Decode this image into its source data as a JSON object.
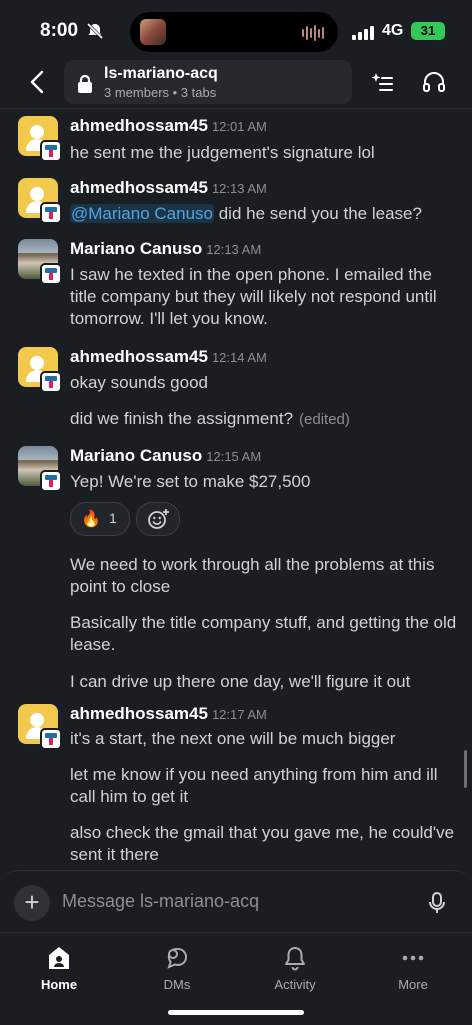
{
  "status_bar": {
    "time": "8:00",
    "network": "4G",
    "battery": "31"
  },
  "header": {
    "channel_name": "ls-mariano-acq",
    "channel_meta": "3 members • 3 tabs"
  },
  "messages": [
    {
      "author": "ahmedhossam45",
      "time": "12:01 AM",
      "lines": [
        "he sent me the judgement's signature lol"
      ]
    },
    {
      "author": "ahmedhossam45",
      "time": "12:13 AM",
      "mention": "@Mariano Canuso",
      "text": " did he send you the lease?"
    },
    {
      "author": "Mariano Canuso",
      "time": "12:13 AM",
      "text": "I saw he texted in the open phone. I emailed the title company but they will likely not respond until tomorrow. I'll let you know."
    },
    {
      "author": "ahmedhossam45",
      "time": "12:14 AM",
      "text": "okay sounds good",
      "followup": "did we finish the assignment?",
      "edited": "(edited)"
    },
    {
      "author": "Mariano Canuso",
      "time": "12:15 AM",
      "text": "Yep! We're set to make $27,500",
      "reaction": {
        "emoji": "🔥",
        "count": "1"
      },
      "followups": [
        "We need to work through all the problems at this point to close",
        "Basically the title company stuff, and getting the old lease.",
        "I can drive up there one day, we'll figure it out"
      ]
    },
    {
      "author": "ahmedhossam45",
      "time": "12:17 AM",
      "text": "it's a start, the next one will be much bigger",
      "followups": [
        "let me know if you need anything from him and ill call him to get it",
        "also check the gmail that you gave me, he could've sent it there"
      ]
    }
  ],
  "composer": {
    "placeholder": "Message ls-mariano-acq"
  },
  "tabs": [
    {
      "label": "Home",
      "icon": "home-icon"
    },
    {
      "label": "DMs",
      "icon": "dms-icon"
    },
    {
      "label": "Activity",
      "icon": "bell-icon"
    },
    {
      "label": "More",
      "icon": "more-icon"
    }
  ]
}
